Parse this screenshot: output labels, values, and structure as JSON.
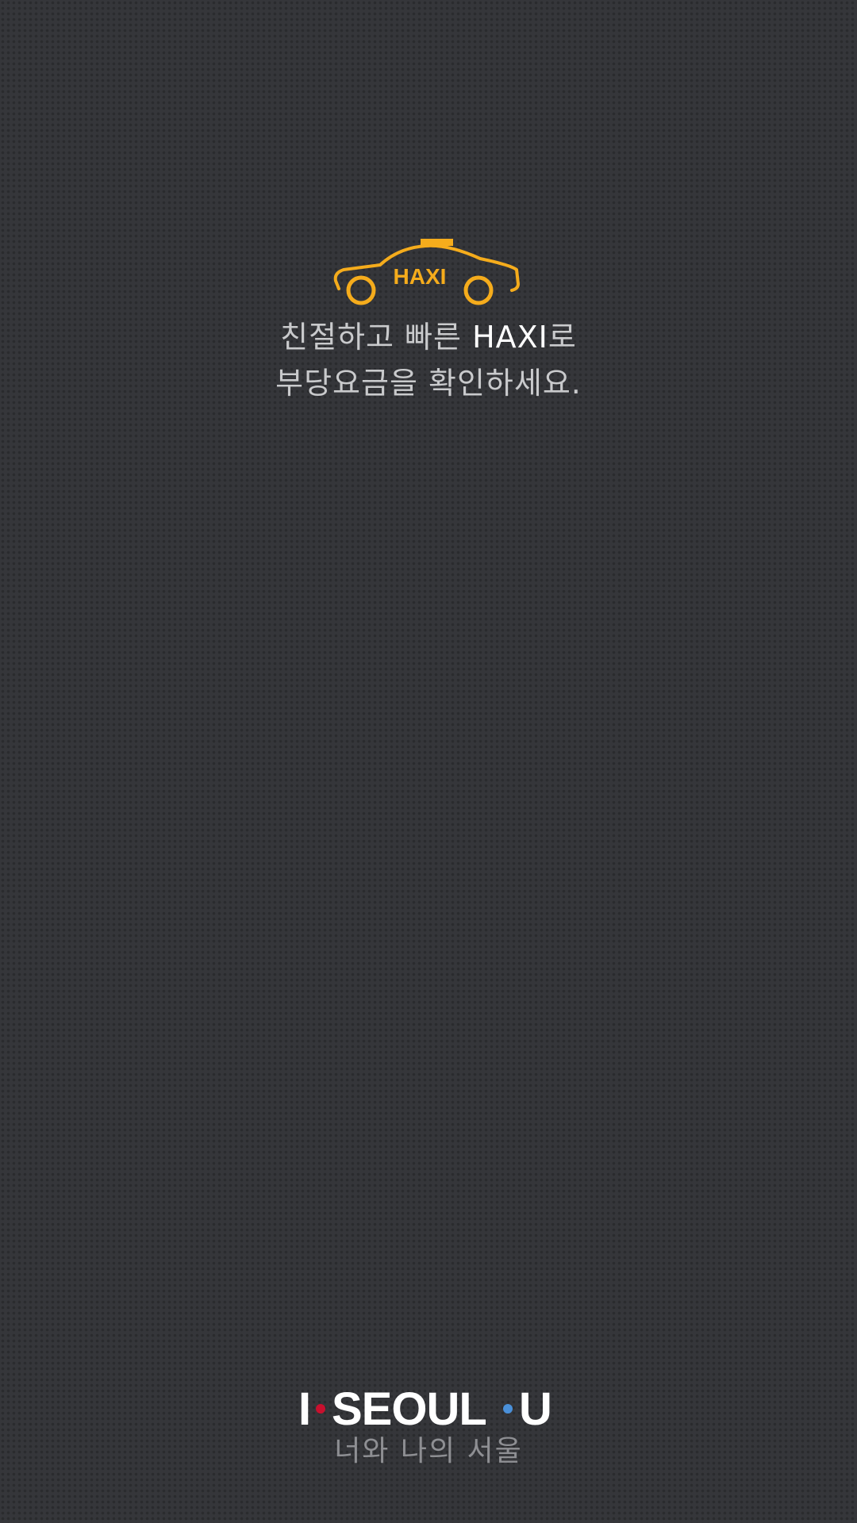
{
  "app": {
    "logo_text": "HAXI",
    "brand_color": "#f5ac1c"
  },
  "tagline": {
    "line1_prefix": "친절하고 빠른 ",
    "line1_brand": "HAXI",
    "line1_suffix": "로",
    "line2": "부당요금을 확인하세요."
  },
  "footer": {
    "logo_i": "I",
    "logo_seoul": "SEOUL",
    "logo_u": "U",
    "subtitle": "너와 나의 서울",
    "dot_red": "#c8102e",
    "dot_blue": "#4a90d9"
  }
}
